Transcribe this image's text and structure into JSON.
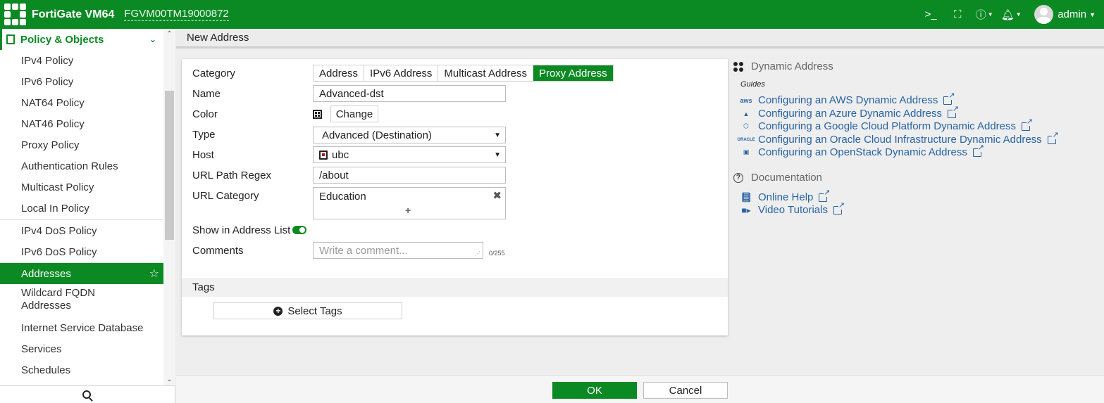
{
  "header": {
    "product": "FortiGate VM64",
    "serial": "FGVM00TM19000872",
    "user": "admin"
  },
  "sidebar": {
    "section": "Policy & Objects",
    "items": [
      {
        "label": "IPv4 Policy"
      },
      {
        "label": "IPv6 Policy"
      },
      {
        "label": "NAT64 Policy"
      },
      {
        "label": "NAT46 Policy"
      },
      {
        "label": "Proxy Policy"
      },
      {
        "label": "Authentication Rules"
      },
      {
        "label": "Multicast Policy"
      },
      {
        "label": "Local In Policy"
      },
      {
        "label": "IPv4 DoS Policy"
      },
      {
        "label": "IPv6 DoS Policy"
      },
      {
        "label": "Addresses",
        "active": true
      },
      {
        "label": "Wildcard FQDN Addresses"
      },
      {
        "label": "Internet Service Database"
      },
      {
        "label": "Services"
      },
      {
        "label": "Schedules"
      }
    ]
  },
  "page": {
    "title": "New Address"
  },
  "form": {
    "category_label": "Category",
    "category_options": [
      "Address",
      "IPv6 Address",
      "Multicast Address",
      "Proxy Address"
    ],
    "category_selected": "Proxy Address",
    "name_label": "Name",
    "name_value": "Advanced-dst",
    "color_label": "Color",
    "change_label": "Change",
    "type_label": "Type",
    "type_value": "Advanced (Destination)",
    "host_label": "Host",
    "host_value": "ubc",
    "url_path_label": "URL Path Regex",
    "url_path_value": "/about",
    "url_category_label": "URL Category",
    "url_category_value": "Education",
    "show_label": "Show in Address List",
    "show_enabled": true,
    "comments_label": "Comments",
    "comments_placeholder": "Write a comment...",
    "comments_counter": "0/255",
    "tags_label": "Tags",
    "select_tags_label": "Select Tags"
  },
  "info": {
    "dynamic_title": "Dynamic Address",
    "guides_label": "Guides",
    "guides": [
      {
        "label": "Configuring an AWS Dynamic Address",
        "icon": "aws-icon"
      },
      {
        "label": "Configuring an Azure Dynamic Address",
        "icon": "azure-icon"
      },
      {
        "label": "Configuring a Google Cloud Platform Dynamic Address",
        "icon": "gcp-icon"
      },
      {
        "label": "Configuring an Oracle Cloud Infrastructure Dynamic Address",
        "icon": "oracle-icon"
      },
      {
        "label": "Configuring an OpenStack Dynamic Address",
        "icon": "openstack-icon"
      }
    ],
    "documentation_title": "Documentation",
    "docs": [
      {
        "label": "Online Help",
        "icon": "book-icon"
      },
      {
        "label": "Video Tutorials",
        "icon": "video-icon"
      }
    ]
  },
  "footer": {
    "ok_label": "OK",
    "cancel_label": "Cancel"
  },
  "colors": {
    "brand": "#0b8a24",
    "link": "#2763a3"
  }
}
